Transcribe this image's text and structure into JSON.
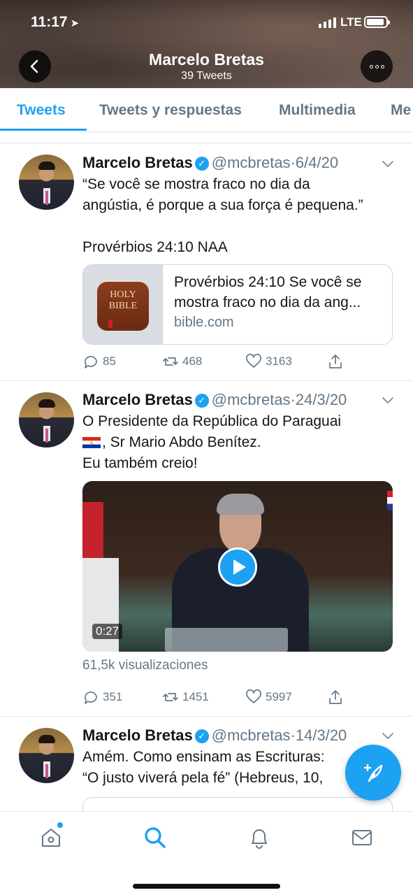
{
  "status_bar": {
    "time": "11:17",
    "network": "LTE"
  },
  "header": {
    "name": "Marcelo Bretas",
    "tweet_count": "39 Tweets"
  },
  "tabs": [
    {
      "label": "Tweets",
      "active": true
    },
    {
      "label": "Tweets y respuestas",
      "active": false
    },
    {
      "label": "Multimedia",
      "active": false
    },
    {
      "label": "Me",
      "active": false
    }
  ],
  "tweets": [
    {
      "name": "Marcelo Bretas",
      "handle": "@mcbretas",
      "sep": "·",
      "date": "6/4/20",
      "lines": [
        "“Se você se mostra fraco no dia da",
        "angústia, é porque a sua força é pequena.”",
        "",
        "Provérbios 24:10 NAA"
      ],
      "card": {
        "icon_text_1": "HOLY",
        "icon_text_2": "BIBLE",
        "title_1": "Provérbios 24:10 Se você se",
        "title_2": "mostra fraco no dia da ang...",
        "domain": "bible.com"
      },
      "replies": "85",
      "retweets": "468",
      "likes": "3163"
    },
    {
      "name": "Marcelo Bretas",
      "handle": "@mcbretas",
      "sep": "·",
      "date": "24/3/20",
      "lines": [
        "O Presidente da República do Paraguai",
        ", Sr Mario Abdo Benítez.",
        "Eu também creio!"
      ],
      "video": {
        "duration": "0:27",
        "views": "61,5k visualizaciones"
      },
      "replies": "351",
      "retweets": "1451",
      "likes": "5997"
    },
    {
      "name": "Marcelo Bretas",
      "handle": "@mcbretas",
      "sep": "·",
      "date": "14/3/20",
      "lines": [
        "Amém. Como ensinam as Escrituras:",
        "“O justo viverá pela fé” (Hebreus, 10,"
      ]
    }
  ],
  "colors": {
    "accent": "#1da1f2",
    "secondary_text": "#657786",
    "border": "#e1e8ed"
  },
  "icons": {
    "back": "chevron-left-icon",
    "more": "more-horizontal-icon",
    "compose": "compose-feather-icon",
    "nav": [
      "home-icon",
      "search-icon",
      "bell-icon",
      "mail-icon"
    ]
  }
}
